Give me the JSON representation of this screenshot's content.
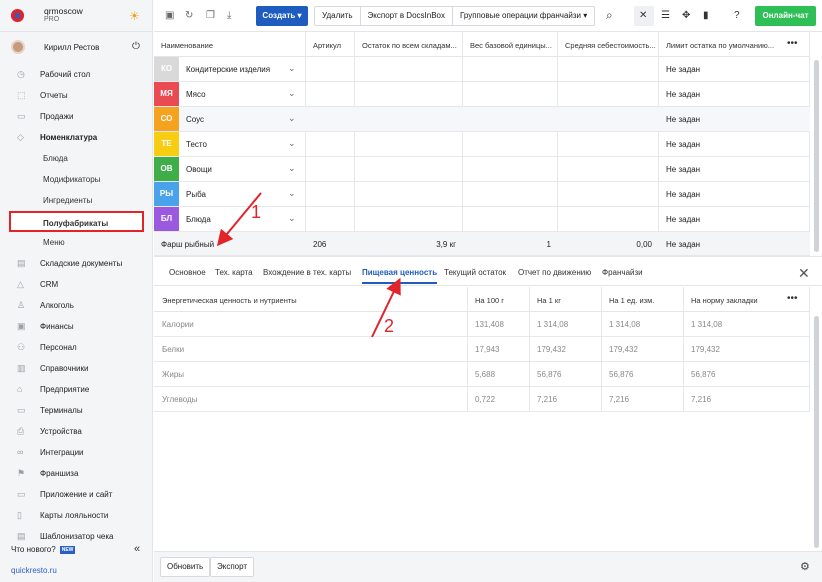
{
  "brand": {
    "name": "qrmoscow",
    "plan": "PRO"
  },
  "user": {
    "name": "Кирилл Рестов"
  },
  "nav": [
    {
      "label": "Рабочий стол",
      "icon": "◷"
    },
    {
      "label": "Отчеты",
      "icon": "⬚"
    },
    {
      "label": "Продажи",
      "icon": "▭"
    },
    {
      "label": "Номенклатура",
      "icon": "◇",
      "bold": true
    },
    {
      "label": "Блюда",
      "sub": true
    },
    {
      "label": "Модификаторы",
      "sub": true
    },
    {
      "label": "Ингредиенты",
      "sub": true
    },
    {
      "label": "Полуфабрикаты",
      "sub": true,
      "active": true
    },
    {
      "label": "Меню",
      "sub": true
    },
    {
      "label": "Складские документы",
      "icon": "▤"
    },
    {
      "label": "CRM",
      "icon": "△"
    },
    {
      "label": "Алкоголь",
      "icon": "♙"
    },
    {
      "label": "Финансы",
      "icon": "▣"
    },
    {
      "label": "Персонал",
      "icon": "⚇"
    },
    {
      "label": "Справочники",
      "icon": "▥"
    },
    {
      "label": "Предприятие",
      "icon": "⌂"
    },
    {
      "label": "Терминалы",
      "icon": "▭"
    },
    {
      "label": "Устройства",
      "icon": "⎙"
    },
    {
      "label": "Интеграции",
      "icon": "∞"
    },
    {
      "label": "Франшиза",
      "icon": "⚑"
    },
    {
      "label": "Приложение и сайт",
      "icon": "▭"
    },
    {
      "label": "Карты лояльности",
      "icon": "▯"
    },
    {
      "label": "Шаблонизатор чека",
      "icon": "▤"
    }
  ],
  "whats_new": {
    "label": "Что нового?",
    "badge": "NEW"
  },
  "site_link": "quickresto.ru",
  "toolbar": {
    "create_label": "Создать ▾",
    "delete_label": "Удалить",
    "export_label": "Экспорт в DocsInBox",
    "group_ops_label": "Групповые операции франчайзи ▾",
    "chat_label": "Онлайн-чат"
  },
  "grid": {
    "columns": [
      "Наименование",
      "Артикул",
      "Остаток по всем складам...",
      "Вес базовой единицы...",
      "Средняя себестоимость...",
      "Лимит остатка по умолчанию..."
    ],
    "rows": [
      {
        "tag": "КО",
        "color": "#d9d9d9",
        "name": "Кондитерские изделия",
        "limit": "Не задан"
      },
      {
        "tag": "МЯ",
        "color": "#ea4b52",
        "name": "Мясо",
        "limit": "Не задан"
      },
      {
        "tag": "СО",
        "color": "#f5a31e",
        "name": "Соус",
        "limit": "Не задан"
      },
      {
        "tag": "ТЕ",
        "color": "#f6cd12",
        "name": "Тесто",
        "limit": "Не задан"
      },
      {
        "tag": "ОВ",
        "color": "#3fae49",
        "name": "Овощи",
        "limit": "Не задан"
      },
      {
        "tag": "РЫ",
        "color": "#4aa3ea",
        "name": "Рыба",
        "limit": "Не задан"
      },
      {
        "tag": "БЛ",
        "color": "#9b59e0",
        "name": "Блюда",
        "limit": "Не задан"
      }
    ],
    "total": {
      "name": "Фарш рыбный",
      "article": "206",
      "stock": "3,9 кг",
      "weight": "1",
      "cost": "0,00",
      "limit": "Не задан"
    }
  },
  "tabs": [
    "Основное",
    "Тех. карта",
    "Вхождение в тех. карты",
    "Пищевая ценность",
    "Текущий остаток",
    "Отчет по движению",
    "Франчайзи"
  ],
  "active_tab": "Пищевая ценность",
  "nutrition": {
    "columns": [
      "Энергетическая ценность и нутриенты",
      "На 100 г",
      "На 1 кг",
      "На 1 ед. изм.",
      "На норму закладки"
    ],
    "rows": [
      {
        "name": "Калории",
        "per100": "131,408",
        "perkg": "1 314,08",
        "perunit": "1 314,08",
        "pernorm": "1 314,08"
      },
      {
        "name": "Белки",
        "per100": "17,943",
        "perkg": "179,432",
        "perunit": "179,432",
        "pernorm": "179,432"
      },
      {
        "name": "Жиры",
        "per100": "5,688",
        "perkg": "56,876",
        "perunit": "56,876",
        "pernorm": "56,876"
      },
      {
        "name": "Углеводы",
        "per100": "0,722",
        "perkg": "7,216",
        "perunit": "7,216",
        "pernorm": "7,216"
      }
    ]
  },
  "footer": {
    "refresh_label": "Обновить",
    "export_label": "Экспорт"
  },
  "annotations": {
    "one": "1",
    "two": "2"
  }
}
